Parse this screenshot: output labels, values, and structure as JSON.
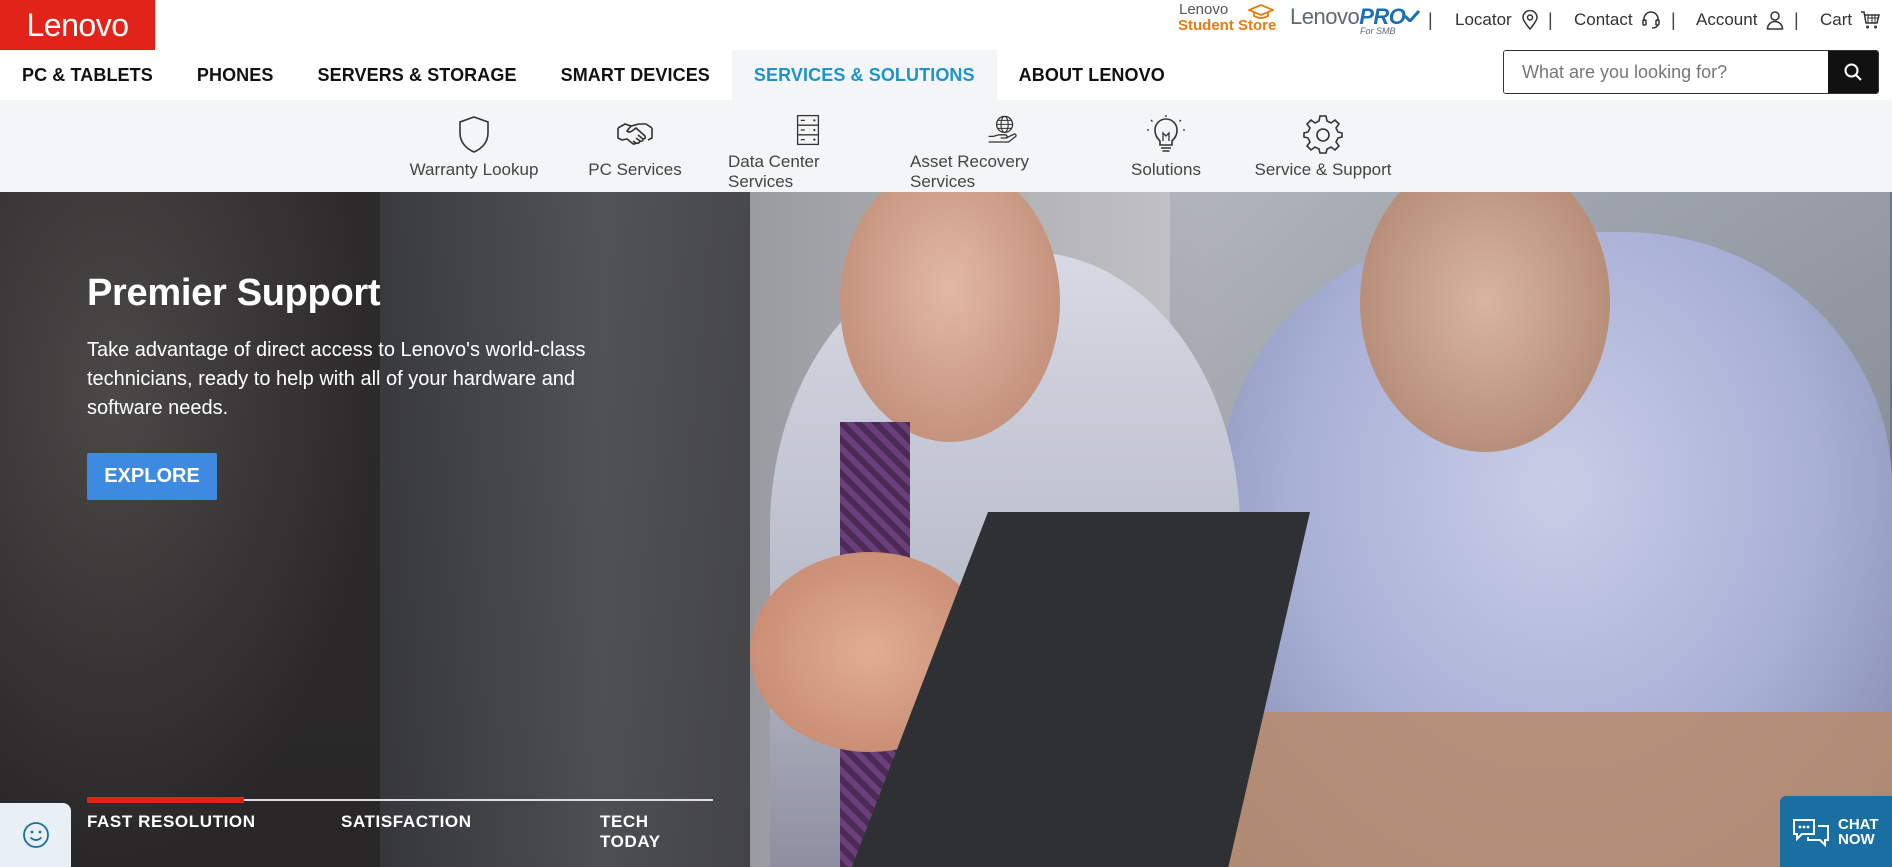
{
  "brand": {
    "logo_text": "Lenovo",
    "accent": "#e2231a"
  },
  "utility": {
    "student_line1": "Lenovo",
    "student_line2": "Student Store",
    "pro_prefix": "Lenovo",
    "pro_suffix": "PRO",
    "pro_sub": "For SMB",
    "locator": "Locator",
    "contact": "Contact",
    "account": "Account",
    "cart": "Cart",
    "pipe": "|"
  },
  "nav": {
    "items": [
      {
        "label": "PC & TABLETS"
      },
      {
        "label": "PHONES"
      },
      {
        "label": "SERVERS & STORAGE"
      },
      {
        "label": "SMART DEVICES"
      },
      {
        "label": "SERVICES & SOLUTIONS"
      },
      {
        "label": "ABOUT LENOVO"
      }
    ],
    "active_color": "#1f93c8"
  },
  "search": {
    "placeholder": "What are you looking for?"
  },
  "subnav": {
    "items": [
      {
        "label": "Warranty Lookup",
        "icon": "shield-icon"
      },
      {
        "label": "PC Services",
        "icon": "handshake-icon"
      },
      {
        "label": "Data Center Services",
        "icon": "server-icon"
      },
      {
        "label": "Asset Recovery Services",
        "icon": "globe-hand-icon"
      },
      {
        "label": "Solutions",
        "icon": "lightbulb-icon"
      },
      {
        "label": "Service & Support",
        "icon": "gear-icon"
      }
    ]
  },
  "hero": {
    "title": "Premier Support",
    "description": "Take advantage of direct access to Lenovo's world-class technicians, ready to help with all of your hardware and software needs.",
    "cta": "EXPLORE",
    "cta_color": "#3d8ae0",
    "tabs": [
      {
        "label": "FAST RESOLUTION"
      },
      {
        "label": "SATISFACTION"
      },
      {
        "label": "TECH TODAY"
      }
    ],
    "active_tab_progress": 0.25
  },
  "chat": {
    "line1": "CHAT",
    "line2": "NOW"
  }
}
